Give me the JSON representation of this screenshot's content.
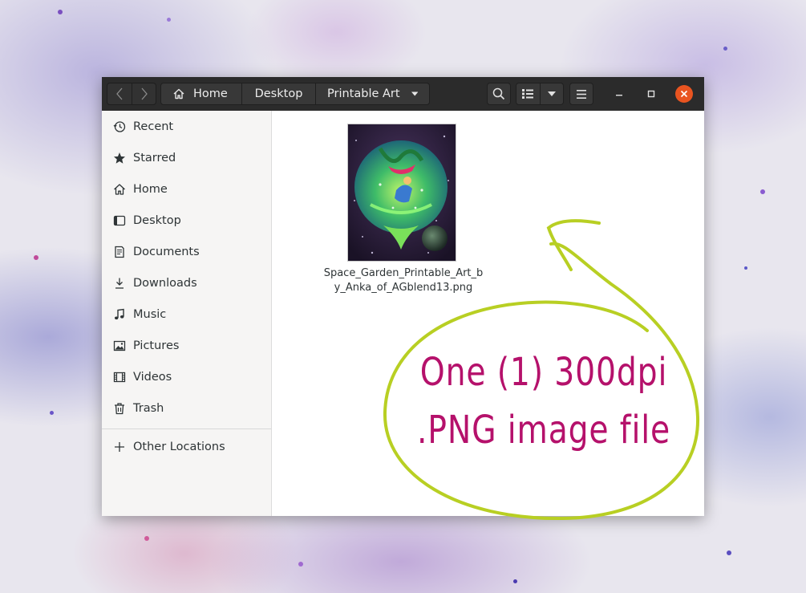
{
  "header": {
    "breadcrumbs": [
      "Home",
      "Desktop",
      "Printable Art"
    ]
  },
  "sidebar": {
    "items": [
      {
        "label": "Recent",
        "icon": "clock-icon"
      },
      {
        "label": "Starred",
        "icon": "star-icon"
      },
      {
        "label": "Home",
        "icon": "home-icon"
      },
      {
        "label": "Desktop",
        "icon": "desktop-icon"
      },
      {
        "label": "Documents",
        "icon": "document-icon"
      },
      {
        "label": "Downloads",
        "icon": "download-icon"
      },
      {
        "label": "Music",
        "icon": "music-note-icon"
      },
      {
        "label": "Pictures",
        "icon": "picture-icon"
      },
      {
        "label": "Videos",
        "icon": "film-icon"
      },
      {
        "label": "Trash",
        "icon": "trash-icon"
      }
    ],
    "other_locations": "Other Locations"
  },
  "files": [
    {
      "name": "Space_Garden_Printable_Art_by_Anka_of_AGblend13.png"
    }
  ],
  "annotation": {
    "line1": "One (1) 300dpi",
    "line2": ".PNG image file"
  },
  "colors": {
    "accent_close": "#e95420",
    "annotation_text": "#b5116b",
    "annotation_loop": "#b8cf23"
  }
}
